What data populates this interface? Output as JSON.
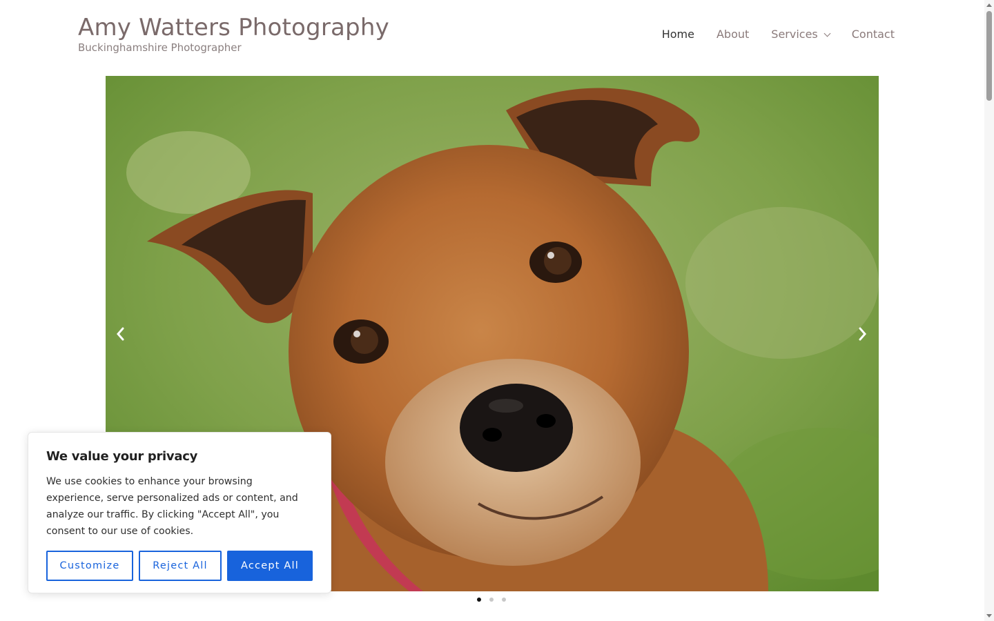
{
  "header": {
    "site_title": "Amy Watters Photography",
    "tagline": "Buckinghamshire Photographer"
  },
  "nav": {
    "items": [
      {
        "label": "Home",
        "active": true
      },
      {
        "label": "About",
        "active": false
      },
      {
        "label": "Services",
        "active": false,
        "has_submenu": true
      },
      {
        "label": "Contact",
        "active": false
      }
    ]
  },
  "slider": {
    "current_slide": 1,
    "slide_count": 3,
    "prev_icon": "chevron-left-icon",
    "next_icon": "chevron-right-icon"
  },
  "cookie_banner": {
    "title": "We value your privacy",
    "text": "We use cookies to enhance your browsing experience, serve personalized ads or content, and analyze our traffic. By clicking \"Accept All\", you consent to our use of cookies.",
    "customize_label": "Customize",
    "reject_label": "Reject All",
    "accept_label": "Accept All"
  },
  "colors": {
    "title": "#7a6a6a",
    "nav_link": "#8a7a7a",
    "nav_active": "#333333",
    "accent": "#1863dc"
  }
}
